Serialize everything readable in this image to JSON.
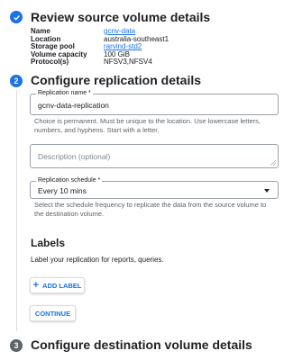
{
  "steps": [
    {
      "number": "✓",
      "title": "Review source volume details",
      "state": "done"
    },
    {
      "number": "2",
      "title": "Configure replication details",
      "state": "active"
    },
    {
      "number": "3",
      "title": "Configure destination volume details",
      "state": "pending"
    }
  ],
  "source_details": {
    "rows": [
      {
        "key": "Name",
        "value": "gcnv-data"
      },
      {
        "key": "Location",
        "value": "australia-southeast1"
      },
      {
        "key": "Storage pool",
        "value": "rarvind-std2"
      },
      {
        "key": "Volume capacity",
        "value": "100 GiB"
      },
      {
        "key": "Protocol(s)",
        "value": "NFSV3,NFSV4"
      }
    ]
  },
  "replication_name": {
    "label": "Replication name *",
    "value": "gcnv-data-replication",
    "help": "Choice is permanent. Must be unique to the location. Use lowercase letters, numbers, and hyphens. Start with a letter."
  },
  "description": {
    "placeholder": "Description (optional)"
  },
  "replication_schedule": {
    "label": "Replication schedule *",
    "value": "Every 10 mins",
    "help": "Select the schedule frequency to replicate the data from the source volume to the destination volume."
  },
  "labels_section": {
    "title": "Labels",
    "description": "Label your replication for reports, queries.",
    "add_label_button": "ADD LABEL"
  },
  "continue_button": "CONTINUE",
  "colors": {
    "accent": "#1a73e8",
    "pending": "#5f6368"
  }
}
